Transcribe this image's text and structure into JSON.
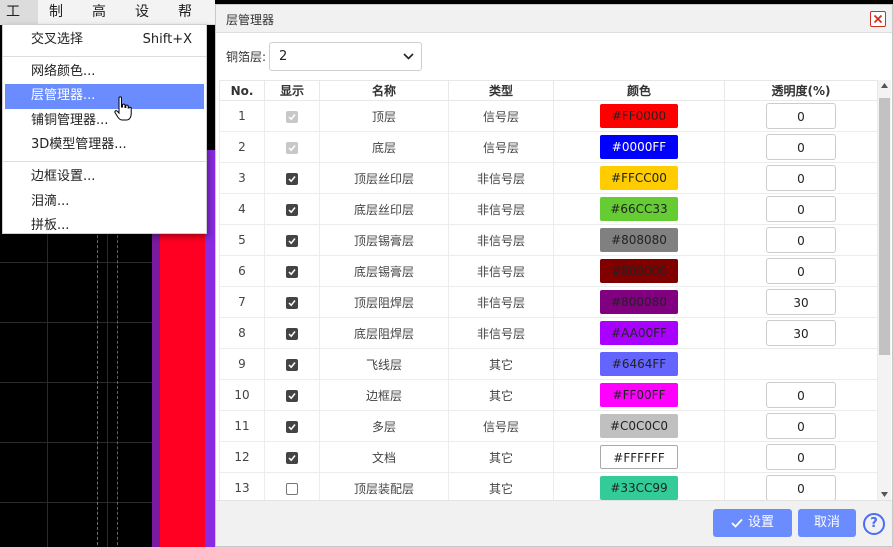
{
  "menubar": {
    "items": [
      "工具",
      "制造",
      "高级",
      "设置",
      "帮助"
    ]
  },
  "tools_menu": {
    "items": [
      {
        "label": "交叉选择",
        "shortcut": "Shift+X"
      },
      {
        "label": "网络颜色..."
      },
      {
        "label": "层管理器..."
      },
      {
        "label": "铺铜管理器..."
      },
      {
        "label": "3D模型管理器..."
      },
      {
        "label": "边框设置..."
      },
      {
        "label": "泪滴..."
      },
      {
        "label": "拼板..."
      }
    ]
  },
  "dialog": {
    "title": "层管理器",
    "copper_layers_label": "铜箔层:",
    "copper_layers_value": "2",
    "columns": [
      "No.",
      "显示",
      "名称",
      "类型",
      "颜色",
      "透明度(%)"
    ],
    "rows": [
      {
        "no": "1",
        "show": "disabled",
        "name": "顶层",
        "type": "信号层",
        "color": "#FF0000",
        "text_color": "#222222",
        "opacity": "0"
      },
      {
        "no": "2",
        "show": "disabled",
        "name": "底层",
        "type": "信号层",
        "color": "#0000FF",
        "text_color": "#ffffff",
        "opacity": "0"
      },
      {
        "no": "3",
        "show": "checked",
        "name": "顶层丝印层",
        "type": "非信号层",
        "color": "#FFCC00",
        "text_color": "#222222",
        "opacity": "0"
      },
      {
        "no": "4",
        "show": "checked",
        "name": "底层丝印层",
        "type": "非信号层",
        "color": "#66CC33",
        "text_color": "#222222",
        "opacity": "0"
      },
      {
        "no": "5",
        "show": "checked",
        "name": "顶层锡膏层",
        "type": "非信号层",
        "color": "#808080",
        "text_color": "#222222",
        "opacity": "0"
      },
      {
        "no": "6",
        "show": "checked",
        "name": "底层锡膏层",
        "type": "非信号层",
        "color": "#800000",
        "text_color": "#222222",
        "opacity": "0"
      },
      {
        "no": "7",
        "show": "checked",
        "name": "顶层阻焊层",
        "type": "非信号层",
        "color": "#800080",
        "text_color": "#222222",
        "opacity": "30"
      },
      {
        "no": "8",
        "show": "checked",
        "name": "底层阻焊层",
        "type": "非信号层",
        "color": "#AA00FF",
        "text_color": "#222222",
        "opacity": "30"
      },
      {
        "no": "9",
        "show": "checked",
        "name": "飞线层",
        "type": "其它",
        "color": "#6464FF",
        "text_color": "#222222",
        "opacity": ""
      },
      {
        "no": "10",
        "show": "checked",
        "name": "边框层",
        "type": "其它",
        "color": "#FF00FF",
        "text_color": "#222222",
        "opacity": "0"
      },
      {
        "no": "11",
        "show": "checked",
        "name": "多层",
        "type": "信号层",
        "color": "#C0C0C0",
        "text_color": "#222222",
        "opacity": "0"
      },
      {
        "no": "12",
        "show": "checked",
        "name": "文档",
        "type": "其它",
        "color": "#FFFFFF",
        "text_color": "#222222",
        "opacity": "0"
      },
      {
        "no": "13",
        "show": "unchecked",
        "name": "顶层装配层",
        "type": "其它",
        "color": "#33CC99",
        "text_color": "#222222",
        "opacity": "0"
      }
    ],
    "ok_label": "设置",
    "cancel_label": "取消"
  }
}
